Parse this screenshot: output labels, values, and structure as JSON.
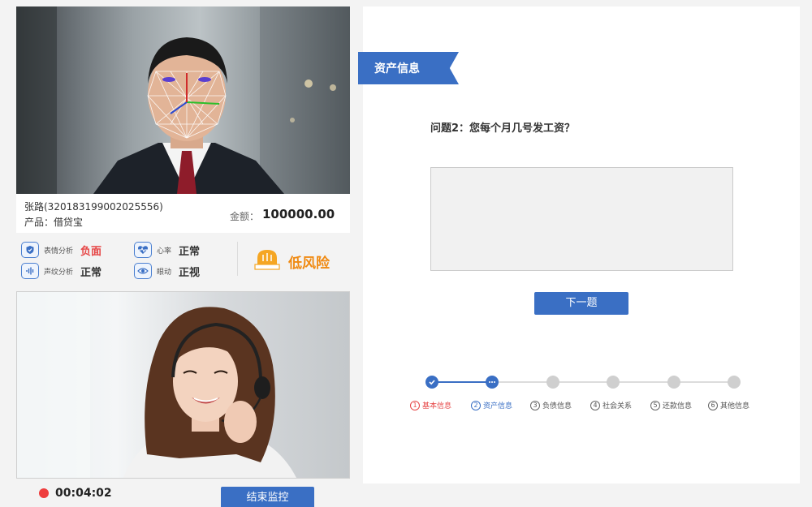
{
  "customer": {
    "name_id": "张路(320183199002025556)",
    "product": "产品：借贷宝",
    "amount_label": "金额：",
    "amount": "100000.00"
  },
  "metrics": [
    {
      "label": "表情分析",
      "value": "负面",
      "icon": "shield-icon"
    },
    {
      "label": "心率",
      "value": "正常",
      "icon": "heart-rate-icon"
    },
    {
      "label": "声纹分析",
      "value": "正常",
      "icon": "voiceprint-icon"
    },
    {
      "label": "眼动",
      "value": "正视",
      "icon": "eye-icon"
    }
  ],
  "risk": {
    "label": "低风险",
    "color": "#f08a12",
    "icon": "warning-light-icon"
  },
  "recording": {
    "time": "00:04:02",
    "end_button": "结束监控"
  },
  "section": {
    "title": "资产信息"
  },
  "question": {
    "text": "问题2：您每个月几号发工资？",
    "answer_value": ""
  },
  "next_button": "下一题",
  "steps": [
    {
      "num": "1",
      "label": "基本信息",
      "state": "done"
    },
    {
      "num": "2",
      "label": "资产信息",
      "state": "active"
    },
    {
      "num": "3",
      "label": "负债信息",
      "state": "pending"
    },
    {
      "num": "4",
      "label": "社会关系",
      "state": "pending"
    },
    {
      "num": "5",
      "label": "还款信息",
      "state": "pending"
    },
    {
      "num": "6",
      "label": "其他信息",
      "state": "pending"
    }
  ],
  "colors": {
    "accent": "#3a6fc4",
    "negative": "#e64545",
    "risk": "#f08a12",
    "record": "#ee3d3d"
  }
}
